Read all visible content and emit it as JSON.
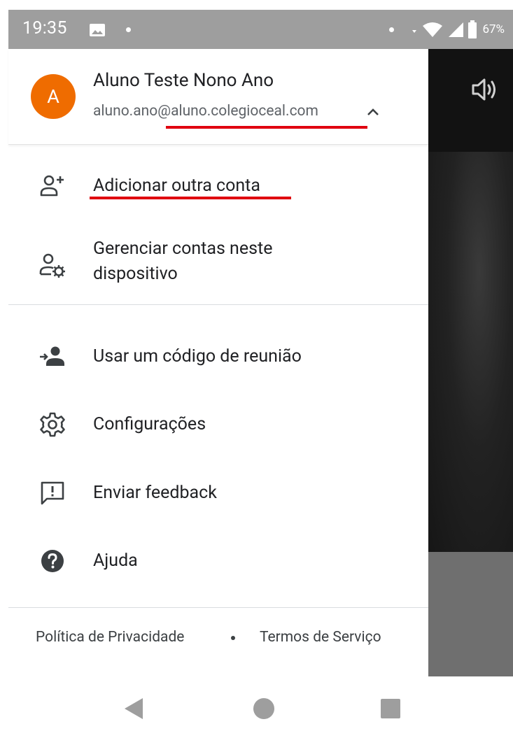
{
  "status_bar": {
    "time": "19:35",
    "battery": "67%"
  },
  "account": {
    "avatar_letter": "A",
    "avatar_color": "#ef6c00",
    "name": "Aluno Teste Nono Ano",
    "email": "aluno.ano@aluno.colegioceal.com"
  },
  "menu": {
    "add_account": "Adicionar outra conta",
    "manage_accounts_line1": "Gerenciar contas neste",
    "manage_accounts_line2": "dispositivo",
    "meeting_code": "Usar um código de reunião",
    "settings": "Configurações",
    "feedback": "Enviar feedback",
    "help": "Ajuda"
  },
  "footer": {
    "privacy": "Política de Privacidade",
    "terms": "Termos de Serviço"
  },
  "annotation_color": "#e0000f",
  "icons": [
    "image-icon",
    "wifi-icon",
    "signal-icon",
    "battery-icon",
    "volume-icon",
    "chevron-up-icon",
    "add-person-icon",
    "manage-accounts-icon",
    "meeting-code-icon",
    "gear-icon",
    "feedback-icon",
    "help-icon",
    "back-icon",
    "home-icon",
    "recents-icon"
  ]
}
